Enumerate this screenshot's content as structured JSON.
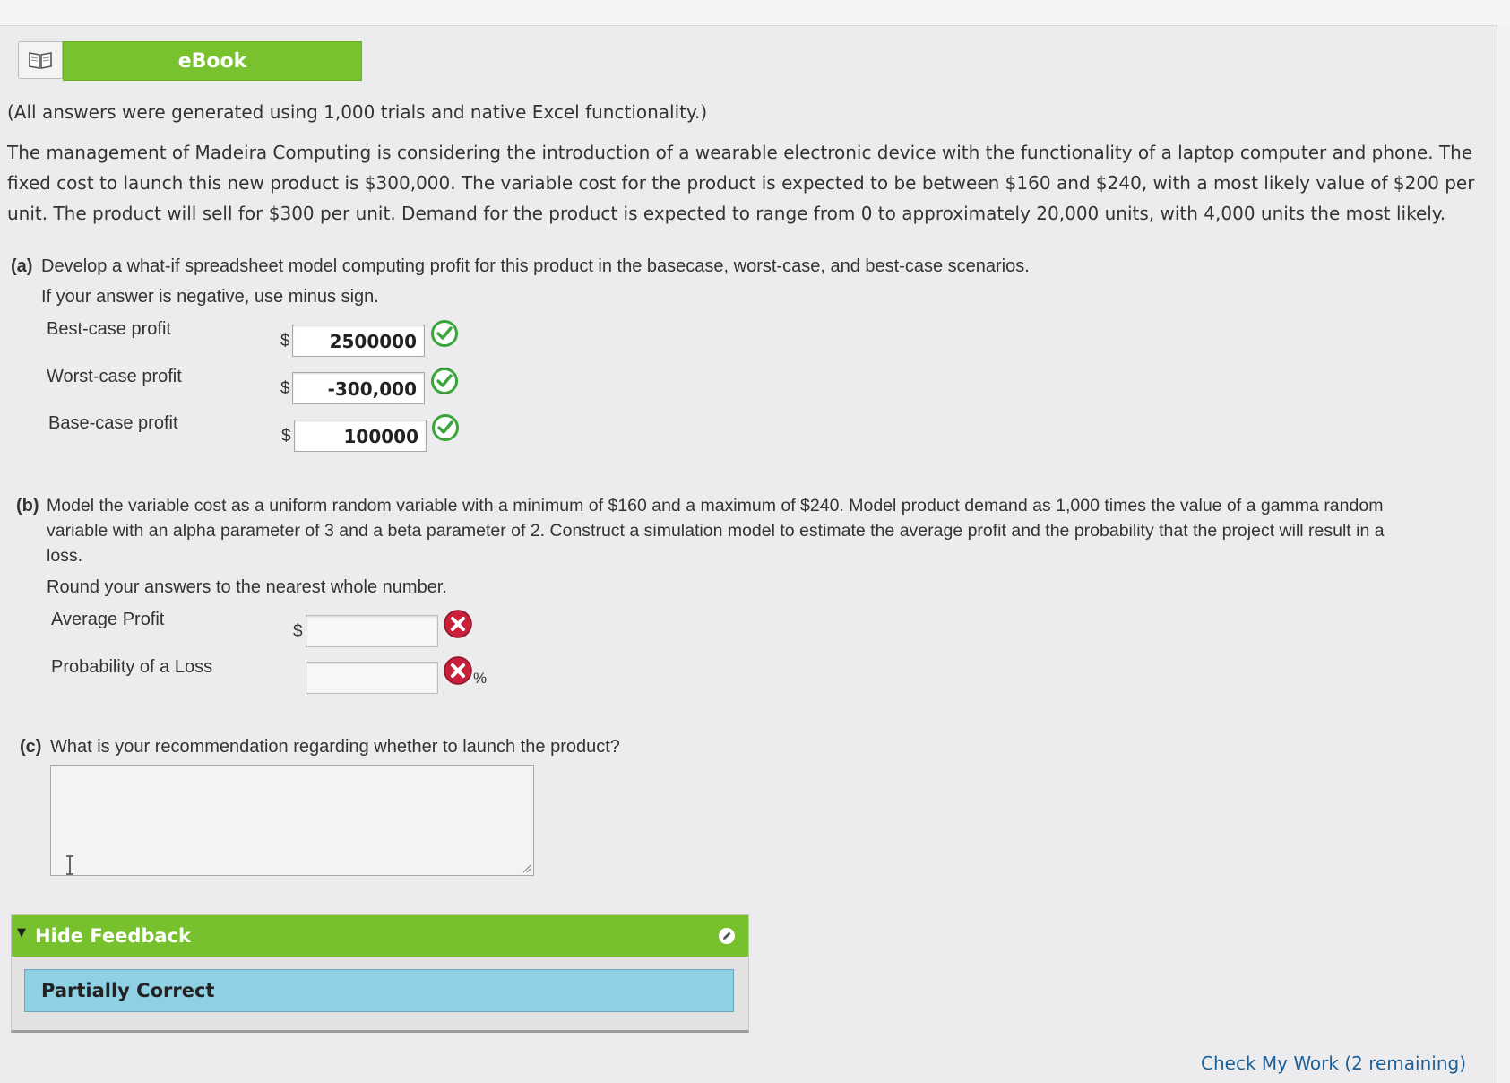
{
  "ebook": {
    "label": "eBook"
  },
  "note": "(All answers were generated using 1,000 trials and native Excel functionality.)",
  "problem": {
    "line1": "The management of Madeira Computing is considering the introduction of a wearable electronic device with the functionality of a laptop computer and phone. The",
    "line2": "fixed cost to launch this new product is $300,000. The variable cost for the product is expected to be between $160 and $240, with a most likely value of $200 per",
    "line3": "unit. The product will sell for $300 per unit. Demand for the product is expected to range from 0 to approximately 20,000 units, with 4,000 units the most likely."
  },
  "part_a": {
    "prefix": "(a)",
    "question": "Develop a what-if spreadsheet model computing profit for this product in the basecase, worst-case, and best-case scenarios.",
    "instruction": "If your answer is negative, use minus sign.",
    "rows": [
      {
        "label": "Best-case profit",
        "currency": "$",
        "value": "2500000",
        "status": "correct"
      },
      {
        "label": "Worst-case profit",
        "currency": "$",
        "value": "-300,000",
        "status": "correct"
      },
      {
        "label": "Base-case profit",
        "currency": "$",
        "value": "100000",
        "status": "correct"
      }
    ]
  },
  "part_b": {
    "prefix": "(b)",
    "line1": "Model the variable cost as a uniform random variable with a minimum of $160 and a maximum of $240. Model product demand as 1,000 times the value of a gamma random",
    "line2": "variable with an alpha parameter of 3 and a beta parameter of 2. Construct a simulation model to estimate the average profit and the probability that the project will result in a",
    "line3": "loss.",
    "instruction": "Round your answers to the nearest whole number.",
    "rows": [
      {
        "label": "Average Profit",
        "currency": "$",
        "value": "",
        "status": "incorrect"
      },
      {
        "label": "Probability of a Loss",
        "unit": "%",
        "value": "",
        "status": "incorrect"
      }
    ]
  },
  "part_c": {
    "prefix": "(c)",
    "question": "What is your recommendation regarding whether to launch the product?",
    "value": ""
  },
  "feedback": {
    "toggle_label": "Hide Feedback",
    "result": "Partially Correct"
  },
  "check_work": "Check My Work (2 remaining)",
  "colors": {
    "accent_green": "#78c230",
    "correct_green": "#3aa63a",
    "incorrect_red": "#c8203a",
    "feedback_blue": "#8fd0e5",
    "link_blue": "#1c5f96"
  }
}
